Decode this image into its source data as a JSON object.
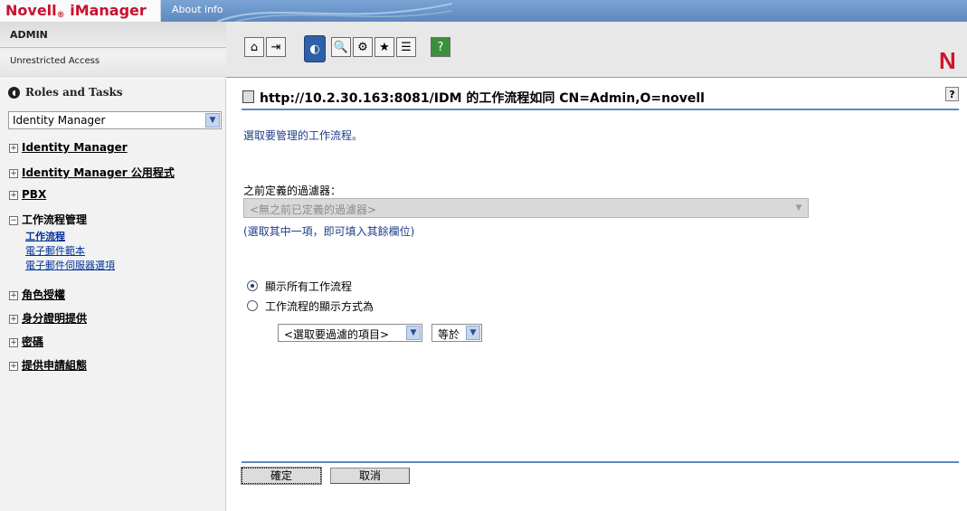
{
  "app": {
    "brand": "Novell",
    "brand_reg": "®",
    "brand_product": " iManager",
    "about_label": "About info",
    "logo_letter": "N"
  },
  "user": {
    "name": "ADMIN",
    "access": "Unrestricted Access"
  },
  "toolbar": {
    "buttons": [
      "home-icon",
      "exit-icon",
      "roles-and-tasks-icon",
      "view-objects-icon",
      "configure-icon",
      "favorites-icon",
      "preferences-icon",
      "help-icon"
    ]
  },
  "sidebar": {
    "header": "Roles and Tasks",
    "role_select_value": "Identity Manager",
    "items": [
      {
        "expander": "⊞",
        "label": "Identity Manager"
      },
      {
        "expander": "⊞",
        "label": "Identity Manager 公用程式"
      },
      {
        "expander": "⊞",
        "label": "PBX"
      },
      {
        "expander": "⊟",
        "label": "工作流程管理"
      },
      {
        "expander": "⊞",
        "label": "角色授權"
      },
      {
        "expander": "⊞",
        "label": "身分證明提供"
      },
      {
        "expander": "⊞",
        "label": "密碼"
      },
      {
        "expander": "⊞",
        "label": "提供申請組態"
      }
    ],
    "subitems": [
      {
        "label": "工作流程"
      },
      {
        "label": "電子郵件範本"
      },
      {
        "label": "電子郵件伺服器選項"
      }
    ]
  },
  "main": {
    "title": "http://10.2.30.163:8081/IDM 的工作流程如同 CN=Admin,O=novell",
    "help_label": "?",
    "instruction": "選取要管理的工作流程。",
    "filter_label": "之前定義的過濾器：",
    "filter_select_value": "<無之前已定義的過濾器>",
    "filter_hint": "(選取其中一項，即可填入其餘欄位)",
    "radio_all": "顯示所有工作流程",
    "radio_filtered": "工作流程的顯示方式為",
    "filter_item_value": "<選取要過濾的項目>",
    "operator_value": "等於",
    "ok_label": "確定",
    "cancel_label": "取消"
  },
  "colors": {
    "banner": "#6a94c6",
    "accent_rule": "#5c88c2",
    "brand_red": "#c8102e",
    "link_blue": "#1e3e8c"
  }
}
